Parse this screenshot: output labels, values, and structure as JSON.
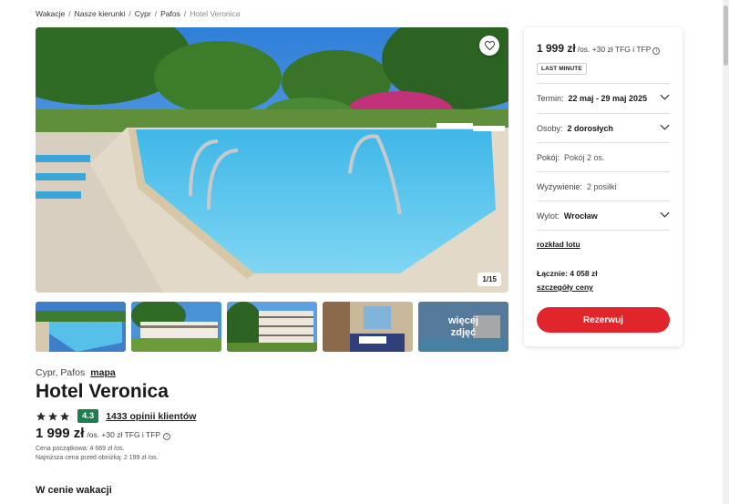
{
  "breadcrumb": {
    "items": [
      "Wakacje",
      "Nasze kierunki",
      "Cypr",
      "Pafos"
    ],
    "current": "Hotel Veronica",
    "separator": "/"
  },
  "gallery": {
    "counter": "1/15",
    "more_line1": "więcej",
    "more_line2": "zdjęć",
    "favorite_icon": "heart-icon"
  },
  "hotel": {
    "location": "Cypr, Pafos",
    "map_link": "mapa",
    "name": "Hotel Veronica",
    "stars": 3,
    "score": "4.3",
    "reviews": "1433 opinii klientów",
    "price": "1 999 zł",
    "price_suffix": "/os. +30 zł TFG i TFP",
    "price_initial": "Cena początkowa: 4 669 zł /os.",
    "price_lowest": "Najniższa cena przed obniżką: 2 199 zł /os."
  },
  "section": {
    "title": "W cenie wakacji"
  },
  "booking": {
    "price": "1 999 zł",
    "price_suffix": "/os. +30 zł TFG i TFP",
    "badge": "LAST MINUTE",
    "term_label": "Termin:",
    "term_value": "22 maj - 29 maj 2025",
    "persons_label": "Osoby:",
    "persons_value": "2 dorosłych",
    "room_label": "Pokój:",
    "room_value": "Pokój 2 os.",
    "board_label": "Wyżywienie:",
    "board_value": "2 posiłki",
    "departure_label": "Wylot:",
    "departure_value": "Wrocław",
    "flight_link": "rozkład lotu",
    "total": "Łącznie: 4 058 zł",
    "details_link": "szczegóły ceny",
    "book_button": "Rezerwuj"
  },
  "colors": {
    "accent": "#e0262c",
    "score_green": "#1e7c4e"
  }
}
